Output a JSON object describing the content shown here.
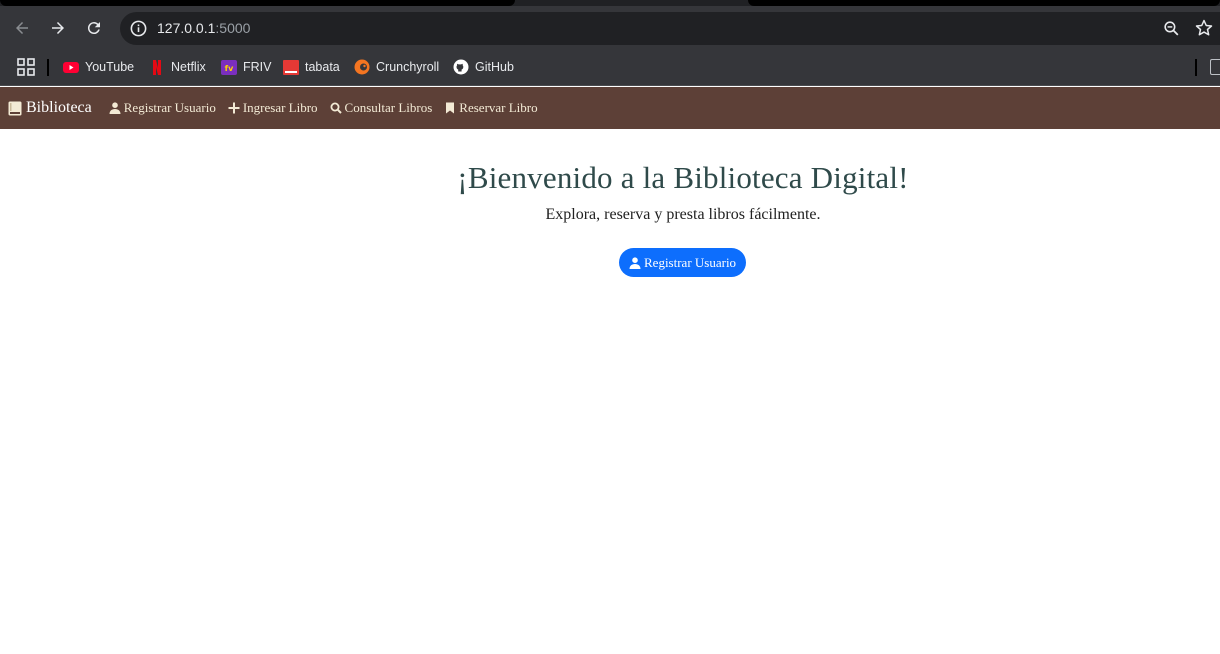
{
  "browser": {
    "url_host": "127.0.0.1",
    "url_port": ":5000",
    "bookmarks": [
      {
        "label": "YouTube",
        "icon": "youtube-icon",
        "color": "#ff0033"
      },
      {
        "label": "Netflix",
        "icon": "netflix-icon",
        "color": "#e50914"
      },
      {
        "label": "FRIV",
        "icon": "friv-icon",
        "color": "#7b2fbe"
      },
      {
        "label": "tabata",
        "icon": "tabata-icon",
        "color": "#e53935"
      },
      {
        "label": "Crunchyroll",
        "icon": "crunchyroll-icon",
        "color": "#f47521"
      },
      {
        "label": "GitHub",
        "icon": "github-icon",
        "color": "#ffffff"
      }
    ]
  },
  "navbar": {
    "brand": "Biblioteca",
    "links": [
      {
        "label": "Registrar Usuario",
        "icon": "user-icon"
      },
      {
        "label": "Ingresar Libro",
        "icon": "plus-icon"
      },
      {
        "label": "Consultar Libros",
        "icon": "search-icon"
      },
      {
        "label": "Reservar Libro",
        "icon": "bookmark-icon"
      }
    ],
    "bg_color": "#5d4037"
  },
  "hero": {
    "title": "¡Bienvenido a la Biblioteca Digital!",
    "subtitle": "Explora, reserva y presta libros fácilmente.",
    "cta_label": "Registrar Usuario",
    "cta_color": "#0d6efd"
  }
}
